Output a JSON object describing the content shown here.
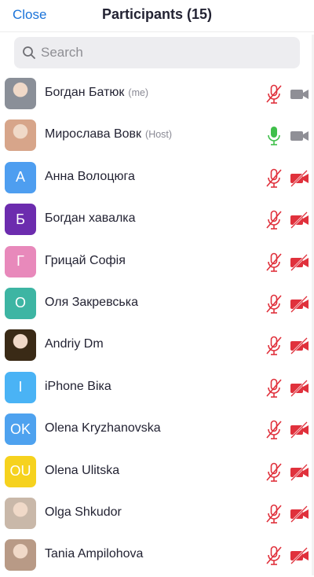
{
  "header": {
    "close_label": "Close",
    "title": "Participants (15)"
  },
  "search": {
    "placeholder": "Search"
  },
  "colors": {
    "accent": "#1a73d9",
    "muted_red": "#e0313c",
    "mic_on_green": "#3fbf4a",
    "cam_gray": "#8f8f96"
  },
  "participants": [
    {
      "name": "Богдан Батюк",
      "role": "(me)",
      "avatar_type": "photo",
      "avatar_text": "",
      "avatar_color": "#8a8f98",
      "mic": "muted",
      "video": "on"
    },
    {
      "name": "Мирослава Вовк",
      "role": "(Host)",
      "avatar_type": "photo",
      "avatar_text": "",
      "avatar_color": "#d7a58a",
      "mic": "active",
      "video": "on"
    },
    {
      "name": "Анна Волоцюга",
      "role": "",
      "avatar_type": "initials",
      "avatar_text": "А",
      "avatar_color": "#4e9ef0",
      "mic": "muted",
      "video": "off"
    },
    {
      "name": "Богдан хавалка",
      "role": "",
      "avatar_type": "initials",
      "avatar_text": "Б",
      "avatar_color": "#6c2cae",
      "mic": "muted",
      "video": "off"
    },
    {
      "name": "Грицай Софія",
      "role": "",
      "avatar_type": "initials",
      "avatar_text": "Г",
      "avatar_color": "#e889bb",
      "mic": "muted",
      "video": "off"
    },
    {
      "name": "Оля Закревська",
      "role": "",
      "avatar_type": "initials",
      "avatar_text": "О",
      "avatar_color": "#3db5a3",
      "mic": "muted",
      "video": "off"
    },
    {
      "name": "Andriy Dm",
      "role": "",
      "avatar_type": "photo",
      "avatar_text": "",
      "avatar_color": "#3a2a16",
      "mic": "muted",
      "video": "off"
    },
    {
      "name": "iPhone Віка",
      "role": "",
      "avatar_type": "initials",
      "avatar_text": "I",
      "avatar_color": "#4ab3f5",
      "mic": "muted",
      "video": "off"
    },
    {
      "name": "Olena Kryzhanovska",
      "role": "",
      "avatar_type": "initials",
      "avatar_text": "OK",
      "avatar_color": "#4ea2ef",
      "mic": "muted",
      "video": "off"
    },
    {
      "name": "Olena Ulitska",
      "role": "",
      "avatar_type": "initials",
      "avatar_text": "OU",
      "avatar_color": "#f6d21e",
      "mic": "muted",
      "video": "off"
    },
    {
      "name": "Olga Shkudor",
      "role": "",
      "avatar_type": "photo",
      "avatar_text": "",
      "avatar_color": "#c9b8a9",
      "mic": "muted",
      "video": "off"
    },
    {
      "name": "Tania Ampilohova",
      "role": "",
      "avatar_type": "photo",
      "avatar_text": "",
      "avatar_color": "#b89a86",
      "mic": "muted",
      "video": "off"
    }
  ]
}
